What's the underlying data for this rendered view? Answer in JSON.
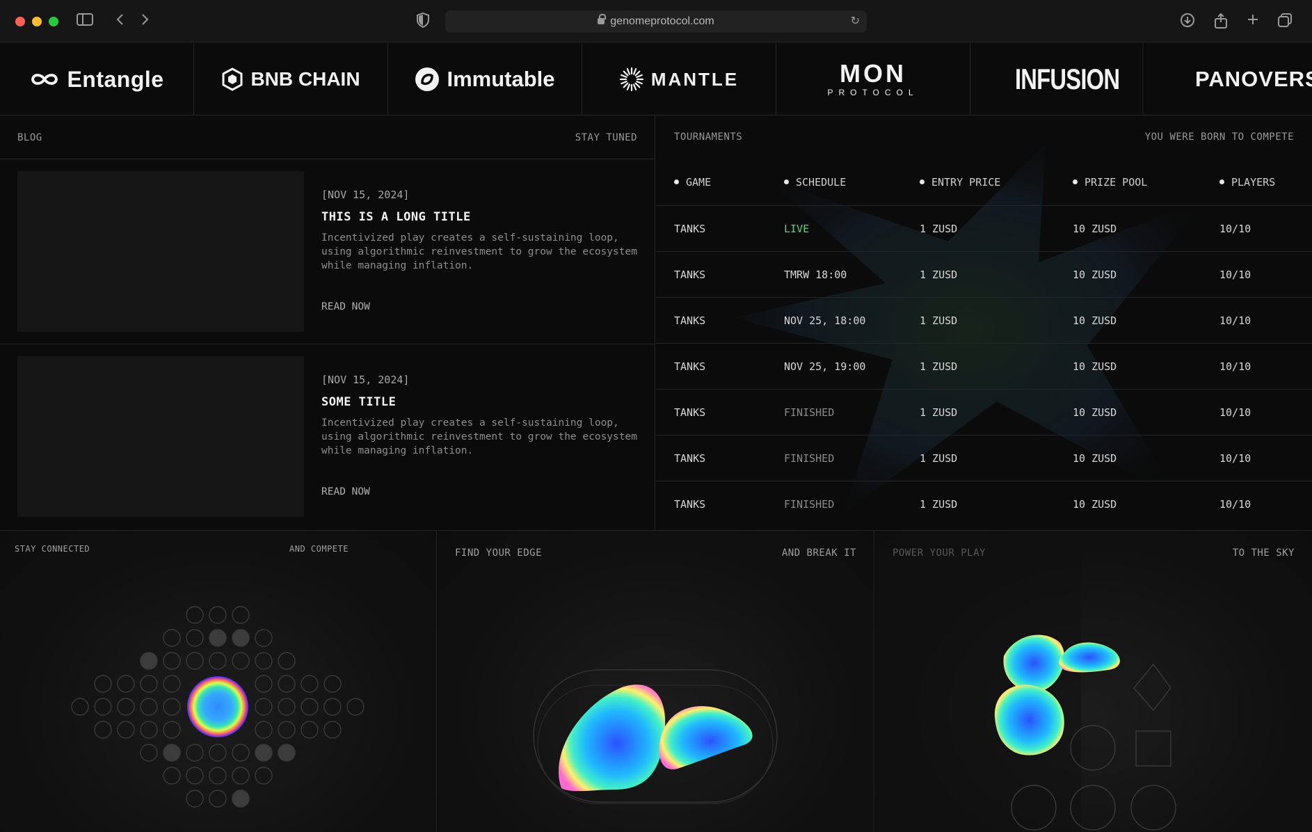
{
  "browser": {
    "url": "genomeprotocol.com"
  },
  "partners": [
    {
      "name": "Entangle"
    },
    {
      "name": "BNB CHAIN"
    },
    {
      "name": "Immutable"
    },
    {
      "name": "MANTLE"
    },
    {
      "name": "MON",
      "sub": "PROTOCOL"
    },
    {
      "name": "INFUSION"
    },
    {
      "name": "PANOVERS"
    }
  ],
  "blog": {
    "title": "BLOG",
    "tagline": "STAY TUNED",
    "posts": [
      {
        "date": "[NOV 15, 2024]",
        "title": "THIS IS A LONG TITLE",
        "body": "Incentivized play creates a self-sustaining loop, using algorithmic reinvestment to grow the ecosystem while managing inflation.",
        "cta": "READ NOW"
      },
      {
        "date": "[NOV 15, 2024]",
        "title": "SOME TITLE",
        "body": "Incentivized play creates a self-sustaining loop, using algorithmic reinvestment to grow the ecosystem while managing inflation.",
        "cta": "READ NOW"
      }
    ]
  },
  "tournaments": {
    "title": "TOURNAMENTS",
    "tagline": "YOU WERE BORN TO COMPETE",
    "columns": [
      "GAME",
      "SCHEDULE",
      "ENTRY PRICE",
      "PRIZE POOL",
      "PLAYERS"
    ],
    "rows": [
      {
        "game": "TANKS",
        "schedule": "LIVE",
        "entry": "1 ZUSD",
        "prize": "10 ZUSD",
        "players": "10/10",
        "status": "live"
      },
      {
        "game": "TANKS",
        "schedule": "TMRW 18:00",
        "entry": "1 ZUSD",
        "prize": "10 ZUSD",
        "players": "10/10",
        "status": "upcoming"
      },
      {
        "game": "TANKS",
        "schedule": "NOV 25, 18:00",
        "entry": "1 ZUSD",
        "prize": "10 ZUSD",
        "players": "10/10",
        "status": "upcoming"
      },
      {
        "game": "TANKS",
        "schedule": "NOV 25, 19:00",
        "entry": "1 ZUSD",
        "prize": "10 ZUSD",
        "players": "10/10",
        "status": "upcoming"
      },
      {
        "game": "TANKS",
        "schedule": "FINISHED",
        "entry": "1 ZUSD",
        "prize": "10 ZUSD",
        "players": "10/10",
        "status": "finished"
      },
      {
        "game": "TANKS",
        "schedule": "FINISHED",
        "entry": "1 ZUSD",
        "prize": "10 ZUSD",
        "players": "10/10",
        "status": "finished"
      },
      {
        "game": "TANKS",
        "schedule": "FINISHED",
        "entry": "1 ZUSD",
        "prize": "10 ZUSD",
        "players": "10/10",
        "status": "finished"
      }
    ]
  },
  "cards": [
    {
      "left": "STAY CONNECTED",
      "right": "AND COMPETE"
    },
    {
      "left": "FIND YOUR EDGE",
      "right": "AND BREAK IT"
    },
    {
      "left": "POWER YOUR PLAY",
      "right": "TO THE SKY"
    }
  ],
  "colors": {
    "background": "#0b0b0b",
    "border": "#262626",
    "live": "#58d57a",
    "muted": "#8a8a8a"
  }
}
